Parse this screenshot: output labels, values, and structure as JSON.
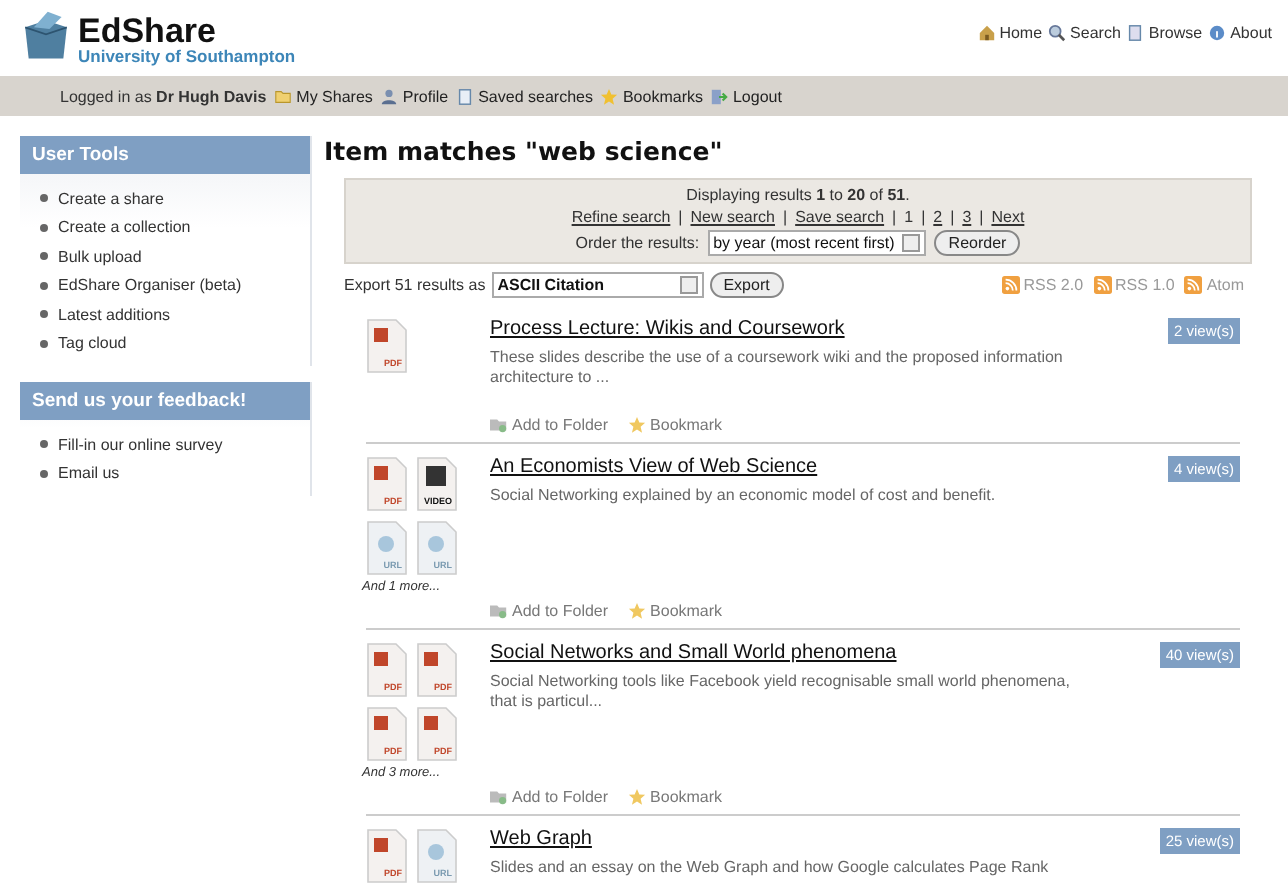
{
  "header": {
    "logo_title": "EdShare",
    "logo_subtitle": "University of Southampton",
    "top_links": [
      {
        "kind": "home",
        "label": "Home"
      },
      {
        "kind": "search",
        "label": "Search"
      },
      {
        "kind": "browse",
        "label": "Browse"
      },
      {
        "kind": "about",
        "label": "About"
      }
    ]
  },
  "user_bar": {
    "logged_in_prefix": "Logged in as",
    "user": "Dr Hugh Davis",
    "links": [
      {
        "kind": "folder",
        "label": "My Shares"
      },
      {
        "kind": "person",
        "label": "Profile"
      },
      {
        "kind": "doc",
        "label": "Saved searches"
      },
      {
        "kind": "star",
        "label": "Bookmarks"
      },
      {
        "kind": "exit",
        "label": "Logout"
      }
    ]
  },
  "sidebar": [
    {
      "title": "User Tools",
      "items": [
        "Create a share",
        "Create a collection",
        "Bulk upload",
        "EdShare Organiser (beta)",
        "Latest additions",
        "Tag cloud"
      ]
    },
    {
      "title": "Send us your feedback!",
      "items": [
        "Fill-in our online survey",
        "Email us"
      ]
    }
  ],
  "page_title": "Item matches \"web science\"",
  "results_box": {
    "summary": "Displaying results **1** to **20** of **51**.",
    "separator": "|",
    "pager": [
      {
        "label": "Refine search",
        "selected": false
      },
      {
        "label": "New search",
        "selected": false
      },
      {
        "label": "Save search",
        "selected": false
      },
      {
        "label": "1",
        "selected": true
      },
      {
        "label": "2",
        "selected": false
      },
      {
        "label": "3",
        "selected": false
      },
      {
        "label": "Next",
        "selected": false
      }
    ],
    "order_label": "Order the results:",
    "order_value": "by year (most recent first)",
    "reorder_button": "Reorder"
  },
  "export": {
    "label": "Export 51 results as",
    "value": "ASCII Citation",
    "button": "Export",
    "feeds": [
      "RSS 2.0",
      "RSS 1.0",
      "Atom"
    ]
  },
  "results": [
    {
      "title": "Process Lecture: Wikis and Coursework",
      "description": "These slides describe the use of a coursework wiki and the proposed information architecture to ...",
      "views": "2 view(s)",
      "files": [
        {
          "kind": "pdf",
          "label": "PDF"
        }
      ],
      "actions": [
        "Add to Folder",
        "Bookmark"
      ]
    },
    {
      "title": "An Economists View of Web Science",
      "description": "Social Networking explained by an economic model of cost and benefit.",
      "views": "4 view(s)",
      "files": [
        {
          "kind": "pdf",
          "label": "PDF"
        },
        {
          "kind": "video",
          "label": "VIDEO"
        },
        {
          "kind": "url",
          "label": "URL"
        },
        {
          "kind": "url",
          "label": "URL"
        }
      ],
      "more": "And 1 more...",
      "actions": [
        "Add to Folder",
        "Bookmark"
      ]
    },
    {
      "title": "Social Networks and Small World phenomena",
      "description": "Social Networking tools like Facebook yield recognisable small world phenomena, that is particul...",
      "views": "40 view(s)",
      "files": [
        {
          "kind": "pdf",
          "label": "PDF"
        },
        {
          "kind": "pdf",
          "label": "PDF"
        },
        {
          "kind": "pdf",
          "label": "PDF"
        },
        {
          "kind": "pdf",
          "label": "PDF"
        }
      ],
      "more": "And 3 more...",
      "actions": [
        "Add to Folder",
        "Bookmark"
      ]
    },
    {
      "title": "Web Graph",
      "description": "Slides and an essay on the Web Graph and how Google calculates Page Rank",
      "views": "25 view(s)",
      "files": [
        {
          "kind": "pdf",
          "label": "PDF"
        },
        {
          "kind": "url",
          "label": "URL"
        }
      ]
    }
  ]
}
